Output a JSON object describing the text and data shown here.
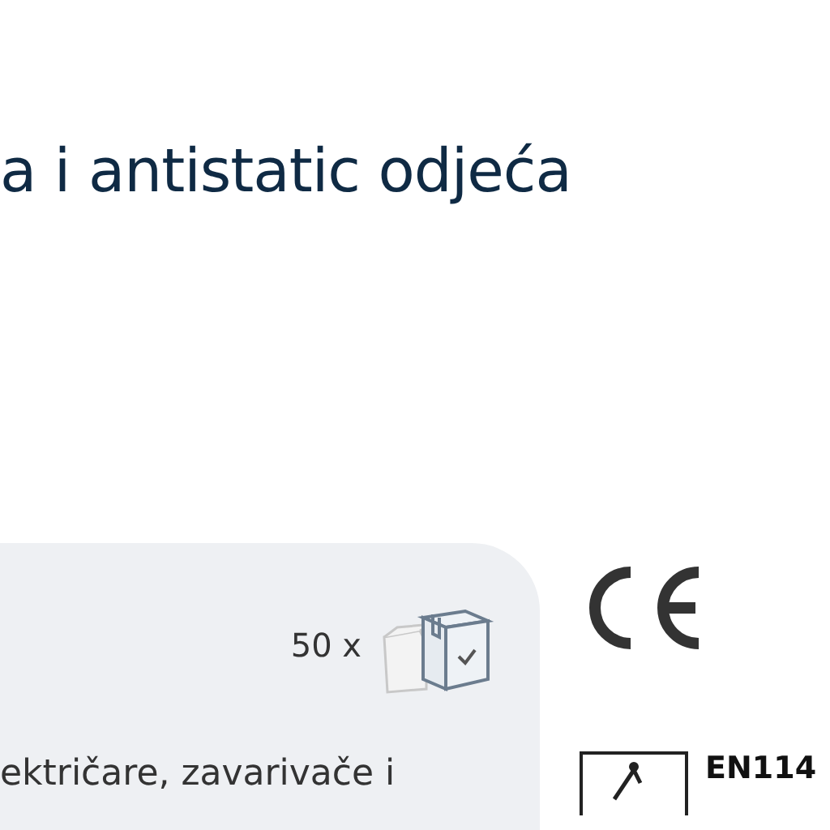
{
  "title": "a i antistatic odjeća",
  "package": {
    "quantity": "50 x",
    "description": "ektričare, zavarivače i"
  },
  "standard": {
    "code": "EN114"
  }
}
